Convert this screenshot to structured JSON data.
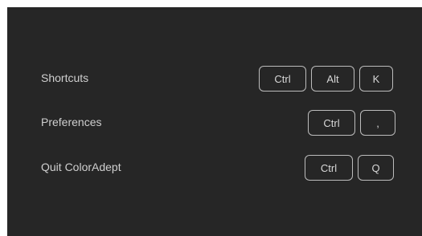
{
  "shortcuts": [
    {
      "label": "Shortcuts",
      "keys": [
        "Ctrl",
        "Alt",
        "K"
      ]
    },
    {
      "label": "Preferences",
      "keys": [
        "Ctrl",
        ","
      ]
    },
    {
      "label": "Quit ColorAdept",
      "keys": [
        "Ctrl",
        "Q"
      ]
    }
  ]
}
